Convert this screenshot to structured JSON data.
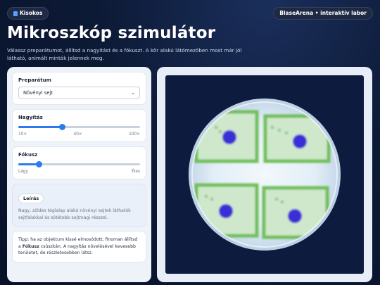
{
  "header": {
    "badge_left": "Kisokos",
    "badge_right": "BlaseArena • interaktív labor",
    "title": "Mikroszkóp szimulátor",
    "subtitle": "Válassz preparátumot, állítsd a nagyítást és a fókuszt. A kör alakú látómezőben most már jól látható, animált minták jelennek meg."
  },
  "controls": {
    "preparatum": {
      "label": "Preparátum",
      "selected": "Növényi sejt"
    },
    "nagyitas": {
      "label": "Nagyítás",
      "min_label": "10×",
      "mid_label": "40×",
      "max_label": "100×",
      "value_fraction": 0.36
    },
    "fokusz": {
      "label": "Fókusz",
      "min_label": "Lágy",
      "max_label": "Éles",
      "value_fraction": 0.17
    },
    "leiras": {
      "chip": "Leírás",
      "text": "Nagy, zöldes téglalap alakú növényi sejtek láthatók sejtfalakkal és sötétebb sejtmagi résszel."
    },
    "tip": {
      "prefix": "Tipp: ha az objektum kissé elmosódott, finoman állítsd a",
      "bold": "Fókusz",
      "suffix": "csúszkán. A nagyítás növelésével kevesebb területet, de részletesebben látsz."
    }
  },
  "colors": {
    "accent": "#2a7bf0",
    "cell_wall": "#6fbf5a",
    "nucleus": "#3b2fd6",
    "viewport_bg": "#0d1b3e"
  }
}
